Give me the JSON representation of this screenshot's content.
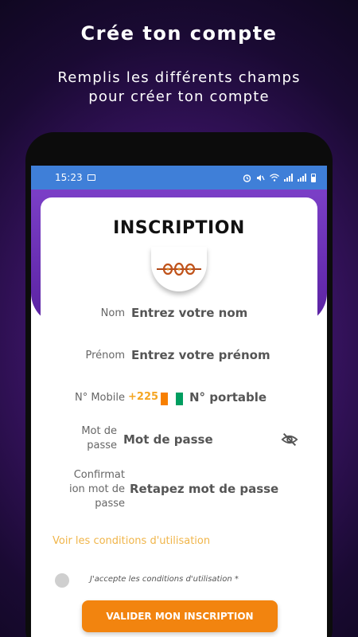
{
  "promo": {
    "title": "Crée ton compte",
    "subtitle": "Remplis les différents champs pour créer ton compte"
  },
  "status_bar": {
    "time": "15:23",
    "icons": [
      "image-icon",
      "alarm-icon",
      "mute-icon",
      "wifi-icon",
      "signal-icon",
      "signal-icon",
      "battery-icon"
    ]
  },
  "form": {
    "heading": "INSCRIPTION",
    "nom": {
      "label": "Nom",
      "placeholder": "Entrez votre nom"
    },
    "prenom": {
      "label": "Prénom",
      "placeholder": "Entrez votre prénom"
    },
    "mobile": {
      "label": "N° Mobile",
      "prefix": "+225",
      "placeholder": "N° portable"
    },
    "password": {
      "label_line1": "Mot de",
      "label_line2": "passe",
      "placeholder": "Mot de passe"
    },
    "confirm": {
      "label_line1": "Confirmat",
      "label_line2": "ion mot de",
      "label_line3": "passe",
      "placeholder": "Retapez mot de passe"
    },
    "terms_link": "Voir les conditions d'utilisation",
    "accept_label": "J'accepte les conditions d'utilisation *",
    "submit_label": "VALIDER MON INSCRIPTION"
  },
  "colors": {
    "accent_orange": "#f2840f",
    "status_blue": "#3f7fd8",
    "header_purple": "#6a2ab5",
    "prefix_gold": "#f5a623",
    "flag_orange": "#f77f00",
    "flag_white": "#ffffff",
    "flag_green": "#009e60"
  }
}
